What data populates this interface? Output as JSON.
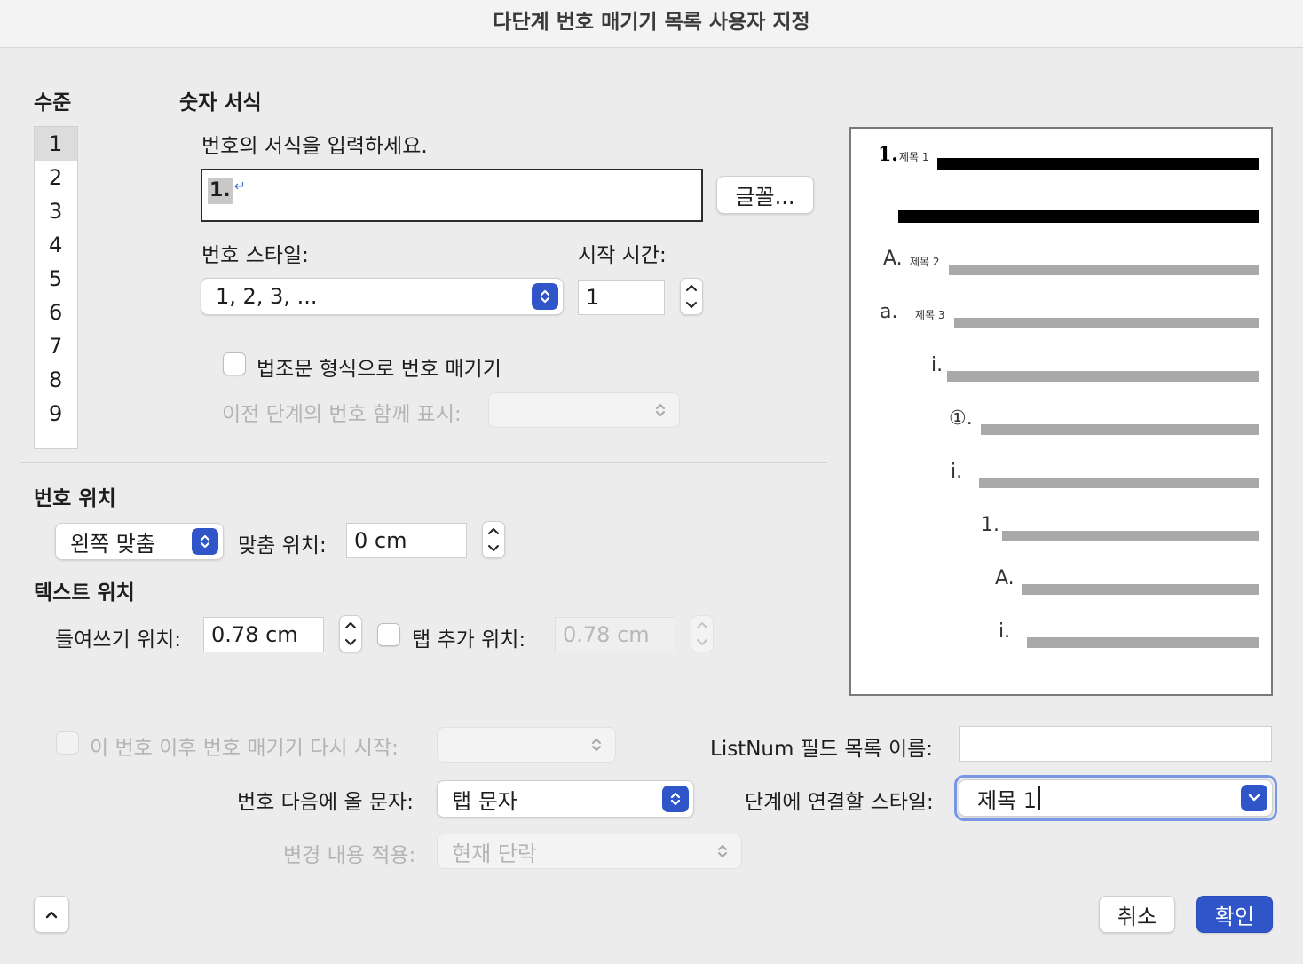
{
  "window": {
    "title": "다단계 번호 매기기 목록 사용자 지정"
  },
  "level_section": {
    "heading": "수준",
    "levels": [
      "1",
      "2",
      "3",
      "4",
      "5",
      "6",
      "7",
      "8",
      "9"
    ],
    "selected": "1"
  },
  "number_format": {
    "heading": "숫자 서식",
    "prompt": "번호의 서식을 입력하세요.",
    "format_value": "1.",
    "paragraph_mark": "↵",
    "font_button": "글꼴...",
    "style_label": "번호 스타일:",
    "style_value": "1, 2, 3, ...",
    "start_label": "시작 시간:",
    "start_value": "1",
    "legal_checkbox_label": "법조문 형식으로 번호 매기기",
    "include_level_label": "이전 단계의 번호 함께 표시:",
    "include_level_value": ""
  },
  "number_position": {
    "heading": "번호 위치",
    "alignment_value": "왼쪽 맞춤",
    "aligned_at_label": "맞춤 위치:",
    "aligned_at_value": "0 cm"
  },
  "text_position": {
    "heading": "텍스트 위치",
    "indent_label": "들여쓰기 위치:",
    "indent_value": "0.78 cm",
    "tab_label": "탭 추가 위치:",
    "tab_value": "0.78 cm"
  },
  "preview": {
    "lines": [
      {
        "number": "1.",
        "label": "제목 1"
      },
      {
        "number": "A.",
        "label": "제목 2"
      },
      {
        "number": "a.",
        "label": "제목 3"
      },
      {
        "number": "i."
      },
      {
        "number": "①."
      },
      {
        "number": "i."
      },
      {
        "number": "1."
      },
      {
        "number": "A."
      },
      {
        "number": "i."
      }
    ]
  },
  "bottom": {
    "restart_label": "이 번호 이후 번호 매기기 다시 시작:",
    "restart_value": "",
    "follow_label": "번호 다음에 올 문자:",
    "follow_value": "탭 문자",
    "apply_label": "변경 내용 적용:",
    "apply_value": "현재 단락",
    "listnum_label": "ListNum 필드 목록 이름:",
    "listnum_value": "",
    "link_style_label": "단계에 연결할 스타일:",
    "link_style_value": "제목 1",
    "cancel_button": "취소",
    "ok_button": "확인"
  },
  "icons": {
    "collapse": "chevron-up-icon",
    "popup": "up-down-chevron-icon",
    "dropdown": "chevron-down-icon"
  },
  "colors": {
    "accent": "#2f55c8",
    "focus_ring": "#7a96e6"
  }
}
